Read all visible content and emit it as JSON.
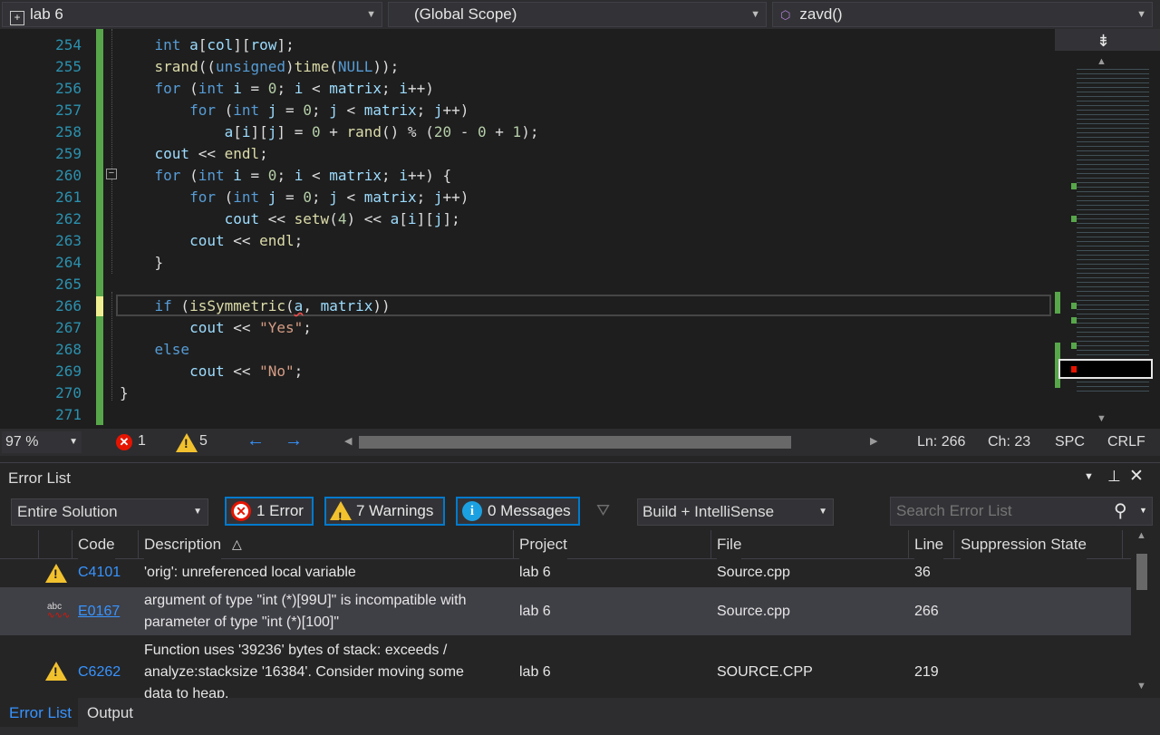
{
  "navbar": {
    "project": "lab 6",
    "scope": "(Global Scope)",
    "member": "zavd()"
  },
  "editor": {
    "line_numbers": [
      "254",
      "255",
      "256",
      "257",
      "258",
      "259",
      "260",
      "261",
      "262",
      "263",
      "264",
      "265",
      "266",
      "267",
      "268",
      "269",
      "270",
      "271"
    ]
  },
  "status": {
    "zoom": "97 %",
    "errors": "1",
    "warnings": "5",
    "ln": "Ln: 266",
    "ch": "Ch: 23",
    "spc": "SPC",
    "crlf": "CRLF"
  },
  "error_list": {
    "title": "Error List",
    "scope_select": "Entire Solution",
    "errors_btn": "1 Error",
    "warnings_btn": "7 Warnings",
    "messages_btn": "0 Messages",
    "build_select": "Build + IntelliSense",
    "search_placeholder": "Search Error List",
    "columns": {
      "code": "Code",
      "description": "Description",
      "project": "Project",
      "file": "File",
      "line": "Line",
      "suppression": "Suppression State"
    },
    "rows": [
      {
        "code": "C4101",
        "description": "'orig': unreferenced local variable",
        "project": "lab 6",
        "file": "Source.cpp",
        "line": "36"
      },
      {
        "code": "E0167",
        "description_1": "argument of type \"int (*)[99U]\" is incompatible with",
        "description_2": "parameter of type \"int (*)[100]\"",
        "project": "lab 6",
        "file": "Source.cpp",
        "line": "266"
      },
      {
        "code": "C6262",
        "description_1": "Function uses '39236' bytes of stack:  exceeds /",
        "description_2": "analyze:stacksize '16384'.  Consider moving some",
        "description_3": "data to heap.",
        "project": "lab 6",
        "file": "SOURCE.CPP",
        "line": "219"
      }
    ]
  },
  "bottom_tabs": {
    "error_list": "Error List",
    "output": "Output"
  },
  "colors": {
    "accent": "#007acc",
    "error": "#e51400",
    "warning": "#f2c12e",
    "info": "#1ba1e2"
  }
}
